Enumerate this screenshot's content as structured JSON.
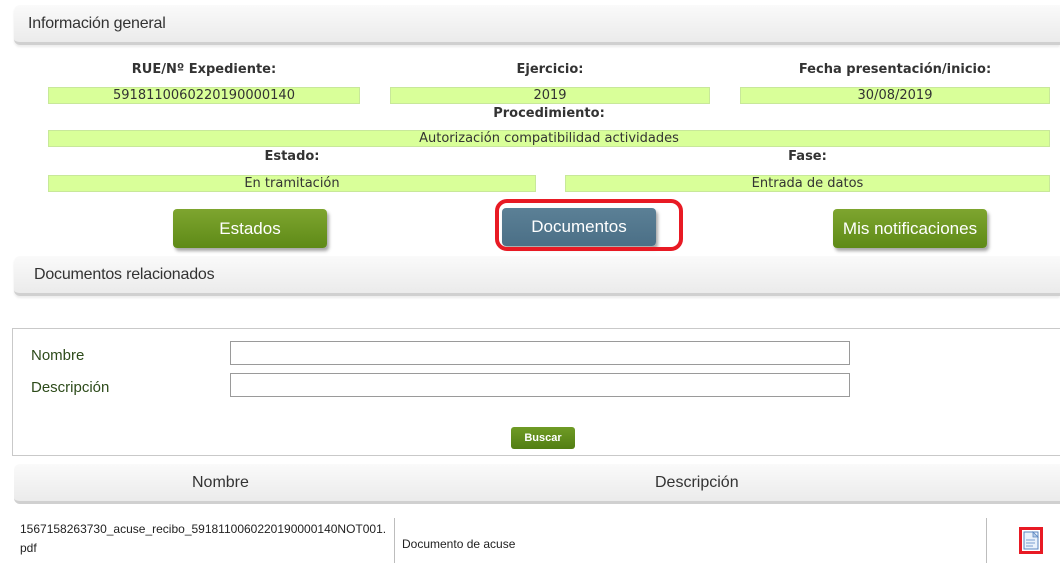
{
  "general_section": {
    "title": "Información general"
  },
  "fields": {
    "rue_label": "RUE/Nº Expediente:",
    "rue_value": "5918110060220190000140",
    "ejercicio_label": "Ejercicio:",
    "ejercicio_value": "2019",
    "fecha_label": "Fecha presentación/inicio:",
    "fecha_value": "30/08/2019",
    "procedimiento_label": "Procedimiento:",
    "procedimiento_value": "Autorización compatibilidad actividades",
    "estado_label": "Estado:",
    "estado_value": "En tramitación",
    "fase_label": "Fase:",
    "fase_value": "Entrada de datos"
  },
  "buttons": {
    "estados": "Estados",
    "documentos": "Documentos",
    "notificaciones": "Mis notificaciones"
  },
  "related_section": {
    "title": "Documentos relacionados"
  },
  "search": {
    "nombre_label": "Nombre",
    "nombre_value": "",
    "descripcion_label": "Descripción",
    "descripcion_value": "",
    "button": "Buscar"
  },
  "table": {
    "headers": [
      "Nombre",
      "Descripción"
    ],
    "rows": [
      {
        "name": "1567158263730_acuse_recibo_5918110060220190000140NOT001.pdf",
        "description": "Documento de acuse",
        "action_icon": "document-icon"
      }
    ]
  },
  "colors": {
    "value_bg": "#d9ff99",
    "green_button": "#6b9524",
    "blue_button": "#527790",
    "highlight": "#e81a24"
  }
}
